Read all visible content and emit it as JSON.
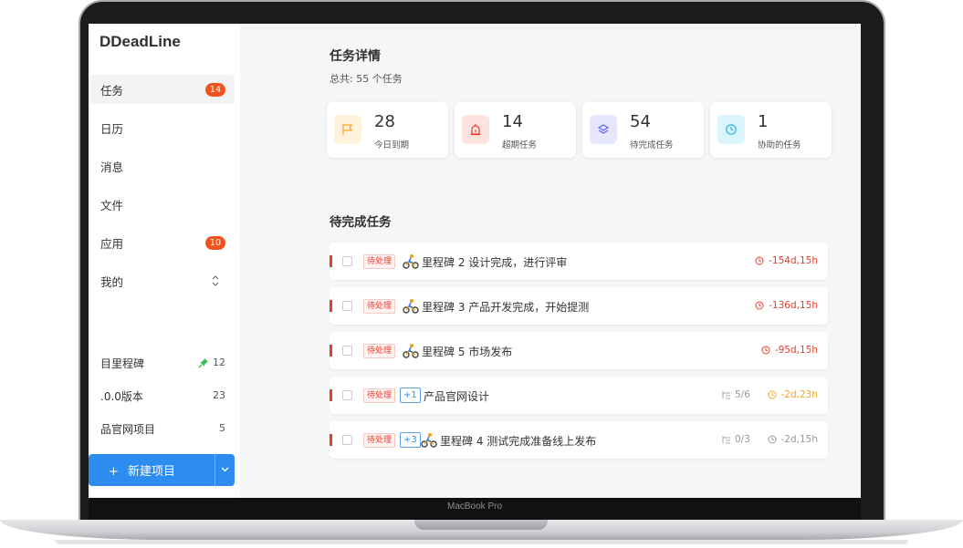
{
  "device": {
    "label": "MacBook Pro"
  },
  "sidebar": {
    "brand": "DDeadLine",
    "nav": [
      {
        "label": "任务",
        "badge": "14"
      },
      {
        "label": "日历"
      },
      {
        "label": "消息"
      },
      {
        "label": "文件"
      },
      {
        "label": "应用",
        "badge": "10"
      },
      {
        "label": "我的"
      }
    ],
    "projects": [
      {
        "name": "目里程碑",
        "count": "12",
        "pinned": true
      },
      {
        "name": ".0.0版本",
        "count": "23"
      },
      {
        "name": "品官网项目",
        "count": "5"
      }
    ],
    "new_project": {
      "plus": "+",
      "label": "新建项目"
    }
  },
  "main": {
    "title": "任务详情",
    "summary": "总共: 55 个任务",
    "stats": [
      {
        "num": "28",
        "label": "今日到期",
        "icon": "flag-icon",
        "color": "#f5a623"
      },
      {
        "num": "14",
        "label": "超期任务",
        "icon": "alarm-icon",
        "color": "#ee3b2c"
      },
      {
        "num": "54",
        "label": "待完成任务",
        "icon": "layers-icon",
        "color": "#6366f1"
      },
      {
        "num": "1",
        "label": "协助的任务",
        "icon": "clock-icon",
        "color": "#22b8e6"
      }
    ],
    "section_title": "待完成任务",
    "tasks": [
      {
        "status": "待处理",
        "name": "里程碑 2 设计完成，进行评审",
        "deadline": "-154d,15h",
        "deadline_color": "#ee3b2c"
      },
      {
        "status": "待处理",
        "name": "里程碑 3 产品开发完成，开始提测",
        "deadline": "-136d,15h",
        "deadline_color": "#ee3b2c"
      },
      {
        "status": "待处理",
        "name": "里程碑 5 市场发布",
        "deadline": "-95d,15h",
        "deadline_color": "#ee3b2c"
      },
      {
        "status": "待处理",
        "plus": "+1",
        "name": "产品官网设计",
        "subtasks": "5/6",
        "deadline": "-2d,23h",
        "deadline_color": "#f5a623"
      },
      {
        "status": "待处理",
        "plus": "+3",
        "name": "里程碑 4 测试完成准备线上发布",
        "subtasks": "0/3",
        "deadline": "-2d,15h",
        "deadline_color": "#999999"
      }
    ]
  }
}
